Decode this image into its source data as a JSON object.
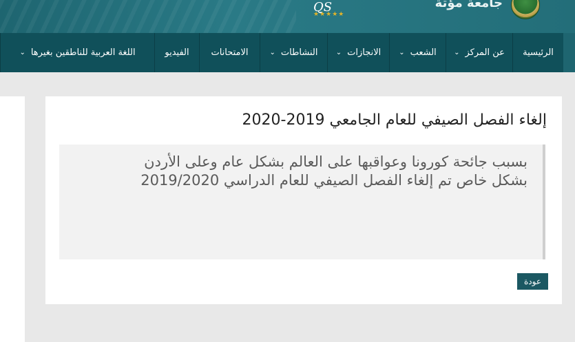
{
  "header": {
    "logo_text": "QS",
    "stars": "★★★★★",
    "calligraphy": "جامعة مؤتة"
  },
  "nav": {
    "items": [
      {
        "label": "الرئيسية",
        "dropdown": false,
        "width": 74
      },
      {
        "label": "عن المركز",
        "dropdown": true,
        "width": 97
      },
      {
        "label": "الشعب",
        "dropdown": true,
        "width": 82
      },
      {
        "label": "الانجازات",
        "dropdown": true,
        "width": 90
      },
      {
        "label": "النشاطات",
        "dropdown": true,
        "width": 98
      },
      {
        "label": "الامتحانات",
        "dropdown": false,
        "width": 88
      },
      {
        "label": "الفيديو",
        "dropdown": false,
        "width": 65
      },
      {
        "label": "اللغة العربية للناطقين بغيرها",
        "dropdown": true,
        "width": 224
      }
    ]
  },
  "article": {
    "title": "إلغاء الفصل الصيفي للعام الجامعي 2019-2020",
    "body_line1": "بسبب جائحة كورونا وعواقبها على العالم بشكل عام وعلى الأردن",
    "body_line2": "بشكل خاص  تم إلغاء الفصل الصيفي للعام الدراسي 2019/2020",
    "back_label": "عودة"
  },
  "colors": {
    "nav_bg": "#10505a",
    "banner_bg": "#236e79",
    "button_bg": "#1b5862",
    "page_gray": "#e8e8e8"
  }
}
